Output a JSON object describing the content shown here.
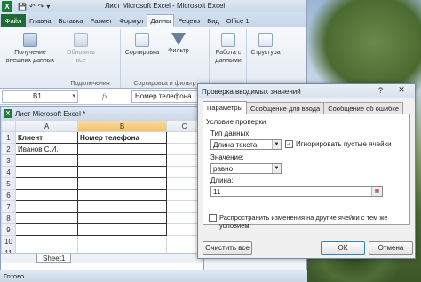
{
  "app": {
    "title": "Лист Microsoft Excel  -  Microsoft Excel",
    "logo": "X"
  },
  "ribbon_tabs": [
    "Файл",
    "Главна",
    "Вставка",
    "Размет",
    "Формул",
    "Данны",
    "Реценз",
    "Вид",
    "Office 1"
  ],
  "ribbon": {
    "groups": {
      "connections": "Подключения",
      "sort_filter": "Сортировка и фильтр",
      "structure_label": ""
    },
    "buttons": {
      "get_external": "Получение внешних данных",
      "refresh_all": "Обновить все",
      "sort": "Сортировка",
      "filter": "Фильтр",
      "data_tools": "Работа с данными",
      "structure": "Структура"
    }
  },
  "formula_bar": {
    "name_box": "B1",
    "fx": "fx",
    "value": "Номер телефона"
  },
  "workbook": {
    "title": "Лист Microsoft Excel *",
    "columns": [
      "A",
      "B",
      "C"
    ],
    "rows": [
      {
        "n": "1",
        "a": "Клиент",
        "b": "Номер телефона"
      },
      {
        "n": "2",
        "a": "Иванов С.И.",
        "b": ""
      },
      {
        "n": "3",
        "a": "",
        "b": ""
      },
      {
        "n": "4",
        "a": "",
        "b": ""
      },
      {
        "n": "5",
        "a": "",
        "b": ""
      },
      {
        "n": "6",
        "a": "",
        "b": ""
      },
      {
        "n": "7",
        "a": "",
        "b": ""
      },
      {
        "n": "8",
        "a": "",
        "b": ""
      },
      {
        "n": "9",
        "a": "",
        "b": ""
      },
      {
        "n": "10",
        "a": "",
        "b": ""
      },
      {
        "n": "11",
        "a": "",
        "b": ""
      }
    ],
    "sheet_tab": "Sheet1"
  },
  "status": {
    "text": "Готово"
  },
  "dialog": {
    "title": "Проверка вводимых значений",
    "help": "?",
    "close": "✕",
    "tabs": [
      "Параметры",
      "Сообщение для ввода",
      "Сообщение об ошибке"
    ],
    "section_title": "Условие проверки",
    "type_label": "Тип данных:",
    "type_value": "Длина текста",
    "ignore_blank": "Игнорировать пустые ячейки",
    "ignore_blank_checked": true,
    "value_label": "Значение:",
    "value_value": "равно",
    "length_label": "Длина:",
    "length_value": "11",
    "propagate_label": "Распространить изменения на другие ячейки с тем же условием",
    "clear_all": "Очистить все",
    "ok": "ОК",
    "cancel": "Отмена"
  },
  "colors": {
    "file_tab": "#1f6b35",
    "excel_green": "#1f7a3a",
    "selected_header": "#f1c15f"
  }
}
